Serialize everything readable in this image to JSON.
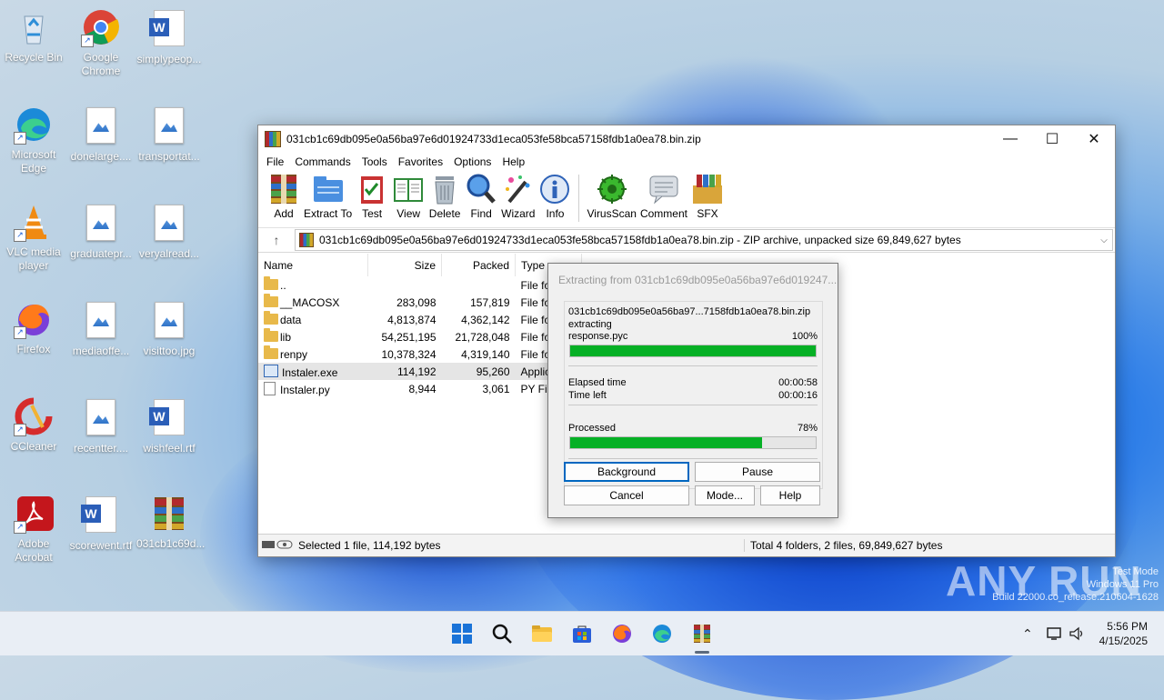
{
  "desktop": {
    "icons": [
      {
        "label": "Recycle Bin",
        "icon": "recycle-bin-icon"
      },
      {
        "label": "Google Chrome",
        "icon": "chrome-icon"
      },
      {
        "label": "simplypeop...",
        "icon": "word-doc-icon"
      },
      {
        "label": "Microsoft Edge",
        "icon": "edge-icon"
      },
      {
        "label": "donelarge....",
        "icon": "image-file-icon"
      },
      {
        "label": "transportat...",
        "icon": "image-file-icon"
      },
      {
        "label": "VLC media player",
        "icon": "vlc-icon"
      },
      {
        "label": "graduatepr...",
        "icon": "image-file-icon"
      },
      {
        "label": "veryalread...",
        "icon": "image-file-icon"
      },
      {
        "label": "Firefox",
        "icon": "firefox-icon"
      },
      {
        "label": "mediaoffe...",
        "icon": "image-file-icon"
      },
      {
        "label": "visittoo.jpg",
        "icon": "image-file-icon"
      },
      {
        "label": "CCleaner",
        "icon": "ccleaner-icon"
      },
      {
        "label": "recentter....",
        "icon": "image-file-icon"
      },
      {
        "label": "wishfeel.rtf",
        "icon": "word-doc-icon"
      },
      {
        "label": "Adobe Acrobat",
        "icon": "acrobat-icon"
      },
      {
        "label": "scorewent.rtf",
        "icon": "word-doc-icon"
      },
      {
        "label": "031cb1c69d...",
        "icon": "winrar-archive-icon"
      }
    ]
  },
  "window": {
    "title": "031cb1c69db095e0a56ba97e6d01924733d1eca053fe58bca57158fdb1a0ea78.bin.zip",
    "controls": {
      "minimize": "—",
      "maximize": "☐",
      "close": "✕"
    },
    "menu": [
      "File",
      "Commands",
      "Tools",
      "Favorites",
      "Options",
      "Help"
    ],
    "toolbar": [
      {
        "label": "Add",
        "icon": "add-archive-icon"
      },
      {
        "label": "Extract To",
        "icon": "extract-to-icon"
      },
      {
        "label": "Test",
        "icon": "test-icon"
      },
      {
        "label": "View",
        "icon": "view-book-icon"
      },
      {
        "label": "Delete",
        "icon": "delete-bin-icon"
      },
      {
        "label": "Find",
        "icon": "find-magnifier-icon"
      },
      {
        "label": "Wizard",
        "icon": "wizard-wand-icon"
      },
      {
        "label": "Info",
        "icon": "info-icon"
      },
      {
        "label": "VirusScan",
        "icon": "virus-scan-icon"
      },
      {
        "label": "Comment",
        "icon": "comment-icon"
      },
      {
        "label": "SFX",
        "icon": "sfx-icon"
      }
    ],
    "path": "031cb1c69db095e0a56ba97e6d01924733d1eca053fe58bca57158fdb1a0ea78.bin.zip - ZIP archive, unpacked size 69,849,627 bytes",
    "columns": {
      "name": "Name",
      "size": "Size",
      "packed": "Packed",
      "type": "Type"
    },
    "files": [
      {
        "name": "..",
        "size": "",
        "packed": "",
        "type": "File fo",
        "kind": "folder"
      },
      {
        "name": "__MACOSX",
        "size": "283,098",
        "packed": "157,819",
        "type": "File fo",
        "kind": "folder"
      },
      {
        "name": "data",
        "size": "4,813,874",
        "packed": "4,362,142",
        "type": "File fo",
        "kind": "folder"
      },
      {
        "name": "lib",
        "size": "54,251,195",
        "packed": "21,728,048",
        "type": "File fo",
        "kind": "folder"
      },
      {
        "name": "renpy",
        "size": "10,378,324",
        "packed": "4,319,140",
        "type": "File fo",
        "kind": "folder"
      },
      {
        "name": "Instaler.exe",
        "size": "114,192",
        "packed": "95,260",
        "type": "Applic",
        "kind": "exe",
        "selected": true
      },
      {
        "name": "Instaler.py",
        "size": "8,944",
        "packed": "3,061",
        "type": "PY File",
        "kind": "py"
      }
    ],
    "status_left": "Selected 1 file, 114,192 bytes",
    "status_right": "Total 4 folders, 2 files, 69,849,627 bytes"
  },
  "dialog": {
    "title": "Extracting from 031cb1c69db095e0a56ba97e6d019247...",
    "archive": "031cb1c69db095e0a56ba97...7158fdb1a0ea78.bin.zip",
    "action": "extracting",
    "file": "response.pyc",
    "file_percent": "100%",
    "file_progress": 1.0,
    "elapsed_label": "Elapsed time",
    "elapsed": "00:00:58",
    "left_label": "Time left",
    "left": "00:00:16",
    "processed_label": "Processed",
    "processed_percent": "78%",
    "processed_progress": 0.78,
    "buttons": {
      "background": "Background",
      "pause": "Pause",
      "cancel": "Cancel",
      "mode": "Mode...",
      "help": "Help"
    }
  },
  "taskbar": {
    "time": "5:56 PM",
    "date": "4/15/2025",
    "apps": [
      "start-icon",
      "search-icon",
      "file-explorer-icon",
      "store-icon",
      "firefox-icon",
      "edge-icon",
      "winrar-icon"
    ]
  },
  "watermark": {
    "line1": "Test Mode",
    "line2": "Windows 11 Pro",
    "line3": "Build 22000.co_release.210604-1628",
    "brand": "ANY RUN"
  },
  "colors": {
    "progress": "#06b025",
    "accent": "#0067c0"
  }
}
